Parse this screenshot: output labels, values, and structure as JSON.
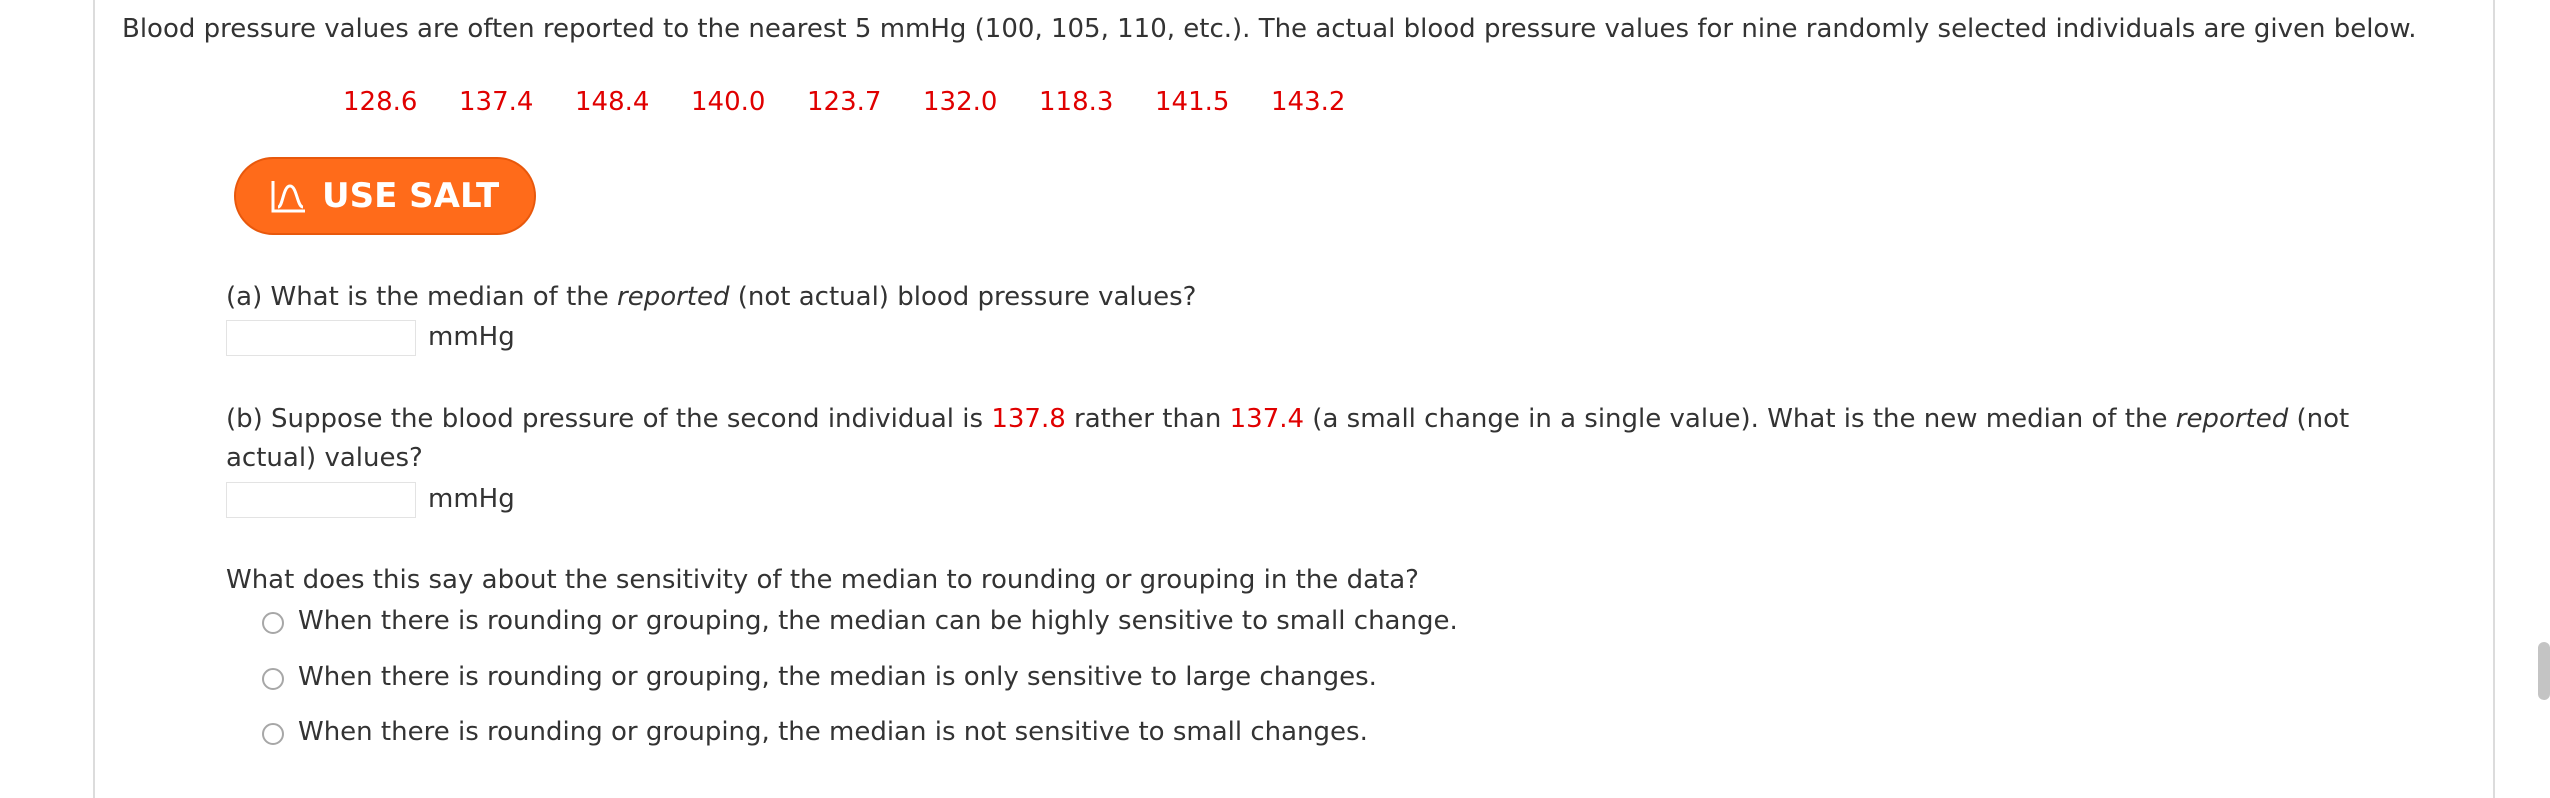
{
  "intro": "Blood pressure values are often reported to the nearest 5 mmHg (100, 105, 110, etc.). The actual blood pressure values for nine randomly selected individuals are given below.",
  "values": [
    "128.6",
    "137.4",
    "148.4",
    "140.0",
    "123.7",
    "132.0",
    "118.3",
    "141.5",
    "143.2"
  ],
  "salt_button": {
    "label": "USE SALT",
    "icon": "salt-chart-icon",
    "color": "#ff6b1a"
  },
  "part_a": {
    "q_prefix": "(a) What is the median of the ",
    "q_em": "reported",
    "q_suffix": " (not actual) blood pressure values?",
    "input_value": "",
    "unit": "mmHg"
  },
  "part_b": {
    "line1_prefix": "(b) Suppose the blood pressure of the second individual is ",
    "new_value": "137.8",
    "middle": " rather than ",
    "old_value": "137.4",
    "line1_suffix": " (a small change in a single value). What is the new median of the ",
    "q_em": "reported",
    "line1_end": " (not",
    "line2": "actual) values?",
    "input_value": "",
    "unit": "mmHg"
  },
  "sensitivity": {
    "question": "What does this say about the sensitivity of the median to rounding or grouping in the data?",
    "options": [
      "When there is rounding or grouping, the median can be highly sensitive to small change.",
      "When there is rounding or grouping, the median is only sensitive to large changes.",
      "When there is rounding or grouping, the median is not sensitive to small changes."
    ]
  },
  "colors": {
    "accent_red": "#e00000",
    "text": "#333333"
  }
}
